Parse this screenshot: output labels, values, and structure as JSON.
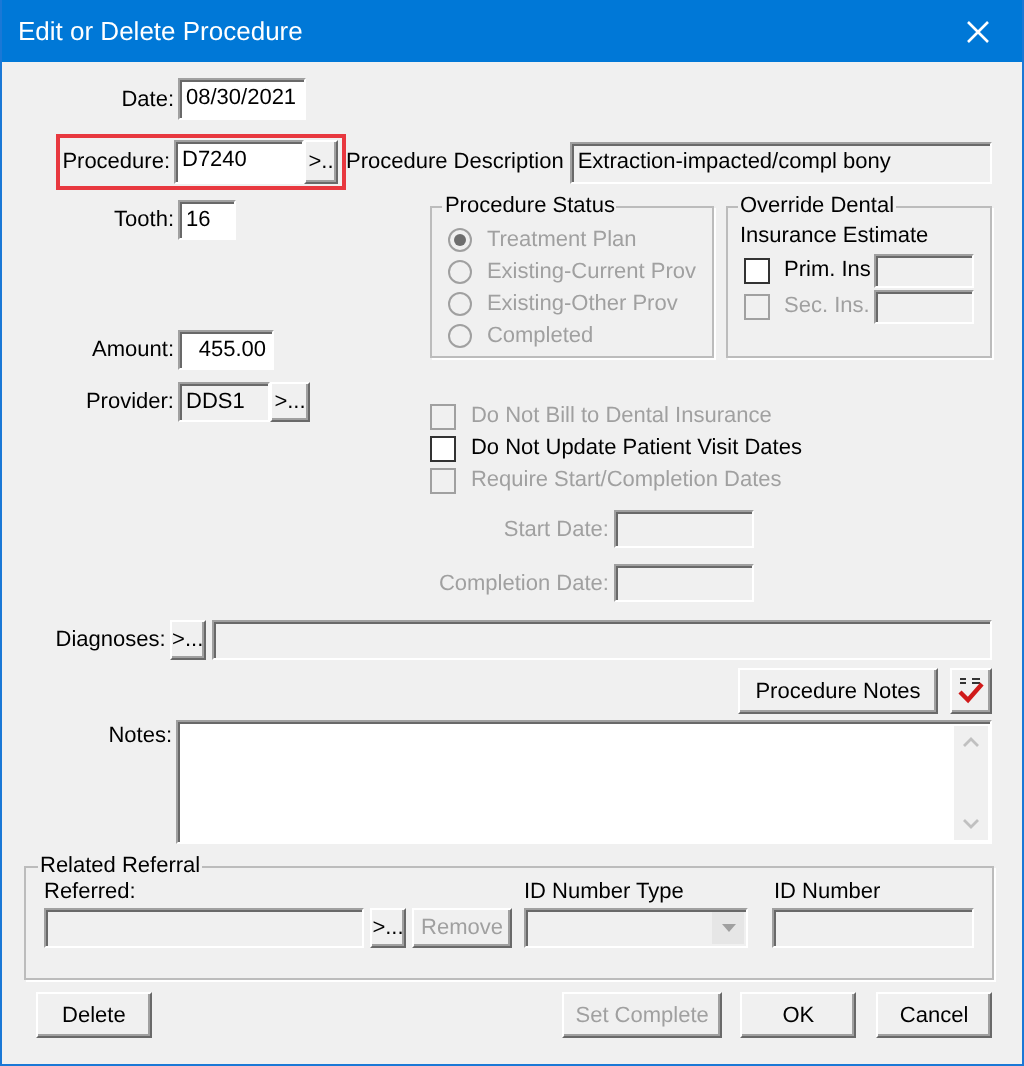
{
  "window": {
    "title": "Edit or Delete Procedure"
  },
  "date": {
    "label": "Date:",
    "value": "08/30/2021"
  },
  "procedure": {
    "label": "Procedure:",
    "value": "D7240",
    "button": ">..",
    "highlighted": true
  },
  "description": {
    "label": "Procedure Description",
    "value": "Extraction-impacted/compl bony"
  },
  "tooth": {
    "label": "Tooth:",
    "value": "16"
  },
  "amount": {
    "label": "Amount:",
    "value": "455.00"
  },
  "provider": {
    "label": "Provider:",
    "value": "DDS1",
    "button": ">..."
  },
  "procedure_status": {
    "title": "Procedure Status",
    "options": [
      {
        "label": "Treatment Plan",
        "selected": true,
        "disabled": true
      },
      {
        "label": "Existing-Current Prov",
        "selected": false,
        "disabled": true
      },
      {
        "label": "Existing-Other Prov",
        "selected": false,
        "disabled": true
      },
      {
        "label": "Completed",
        "selected": false,
        "disabled": true
      }
    ]
  },
  "override": {
    "title": "Override Dental",
    "subtitle": "Insurance Estimate",
    "items": [
      {
        "label": "Prim. Ins",
        "checked": false,
        "disabled": false
      },
      {
        "label": "Sec. Ins.",
        "checked": false,
        "disabled": true
      }
    ]
  },
  "options": [
    {
      "label": "Do Not Bill to Dental Insurance",
      "checked": false,
      "disabled": true
    },
    {
      "label": "Do Not Update Patient Visit Dates",
      "checked": false,
      "disabled": false
    },
    {
      "label": "Require Start/Completion Dates",
      "checked": false,
      "disabled": true
    }
  ],
  "dates": [
    {
      "label": "Start Date:",
      "disabled": true
    },
    {
      "label": "Completion Date:",
      "disabled": true
    }
  ],
  "diagnoses": {
    "label": "Diagnoses:",
    "button": ">..."
  },
  "procedure_notes_button": "Procedure Notes",
  "notes": {
    "label": "Notes:"
  },
  "referral": {
    "title": "Related Referral",
    "referred_label": "Referred:",
    "browse_button": ">...",
    "remove_button": {
      "label": "Remove",
      "disabled": true
    },
    "id_type_label": "ID Number Type",
    "id_number_label": "ID Number"
  },
  "buttons": [
    {
      "label": "Delete",
      "disabled": false
    },
    {
      "label": "Set Complete",
      "disabled": true
    },
    {
      "label": "OK",
      "disabled": false
    },
    {
      "label": "Cancel",
      "disabled": false
    }
  ]
}
